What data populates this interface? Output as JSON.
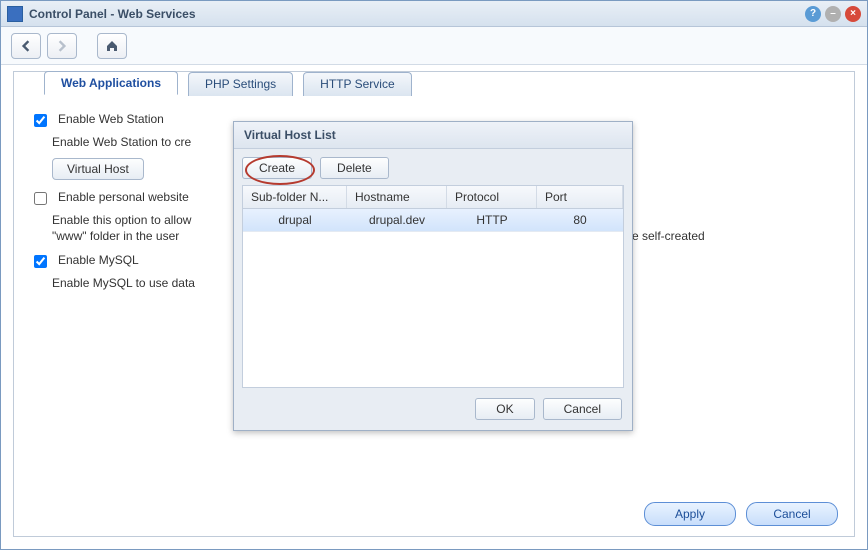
{
  "title": "Control Panel - Web Services",
  "tabs": [
    {
      "label": "Web Applications",
      "active": true
    },
    {
      "label": "PHP Settings",
      "active": false
    },
    {
      "label": "HTTP Service",
      "active": false
    }
  ],
  "options": {
    "web_station": {
      "label": "Enable Web Station",
      "checked": true,
      "desc": "Enable Web Station to cre",
      "button": "Virtual Host"
    },
    "personal": {
      "label": "Enable personal website",
      "checked": false,
      "desc": "Enable this option to allow\n\"www\" folder in the user",
      "desc_tail": "ges to the self-created"
    },
    "mysql": {
      "label": "Enable MySQL",
      "checked": true,
      "desc": "Enable MySQL to use data"
    }
  },
  "footer": {
    "apply": "Apply",
    "cancel": "Cancel"
  },
  "modal": {
    "title": "Virtual Host List",
    "buttons": {
      "create": "Create",
      "delete": "Delete"
    },
    "columns": [
      "Sub-folder N...",
      "Hostname",
      "Protocol",
      "Port"
    ],
    "rows": [
      {
        "subfolder": "drupal",
        "hostname": "drupal.dev",
        "protocol": "HTTP",
        "port": "80",
        "selected": true
      }
    ],
    "footer": {
      "ok": "OK",
      "cancel": "Cancel"
    }
  }
}
